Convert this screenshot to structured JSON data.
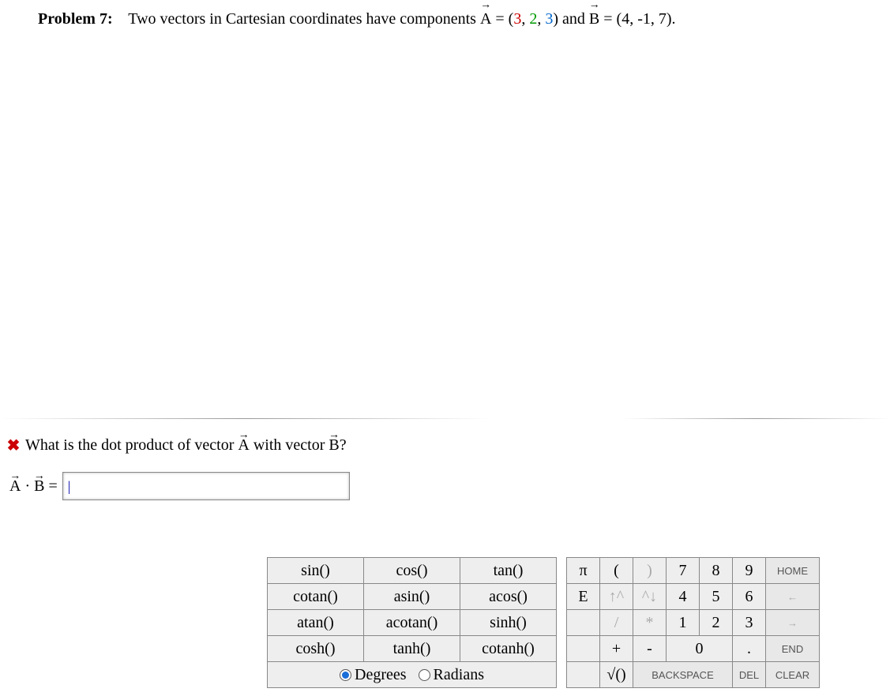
{
  "problem": {
    "label": "Problem 7:",
    "stem_prefix": "Two vectors in Cartesian coordinates have components ",
    "vecA_name": "A",
    "vecA_eq": " = (",
    "A1": "3",
    "A_sep1": ", ",
    "A2": "2",
    "A_sep2": ", ",
    "A3": "3",
    "vecA_close": ") and ",
    "vecB_name": "B",
    "vecB_eq": " = (4, -1, 7)."
  },
  "question": {
    "mark": "✖",
    "text_prefix": "What is the dot product of vector ",
    "vecA": "A",
    "text_mid": " with vector ",
    "vecB": "B",
    "text_end": "?"
  },
  "answer": {
    "vecA": "A",
    "dot": "·",
    "vecB": "B",
    "eq": " = ",
    "value": "",
    "placeholder": "|"
  },
  "keypad": {
    "fn": [
      [
        "sin()",
        "cos()",
        "tan()"
      ],
      [
        "cotan()",
        "asin()",
        "acos()"
      ],
      [
        "atan()",
        "acotan()",
        "sinh()"
      ],
      [
        "cosh()",
        "tanh()",
        "cotanh()"
      ]
    ],
    "mode": {
      "degrees": "Degrees",
      "radians": "Radians",
      "selected": "degrees"
    },
    "num": {
      "r1": [
        "π",
        "(",
        ")",
        "7",
        "8",
        "9",
        "HOME"
      ],
      "r2": [
        "E",
        "↑^",
        "^↓",
        "4",
        "5",
        "6",
        "←"
      ],
      "r3": [
        "",
        "/",
        "*",
        "1",
        "2",
        "3",
        "→"
      ],
      "r4": [
        "",
        "+",
        "-",
        "0",
        ".",
        "END"
      ],
      "r5": [
        "",
        "√()",
        "BACKSPACE",
        "DEL",
        "CLEAR"
      ]
    }
  }
}
